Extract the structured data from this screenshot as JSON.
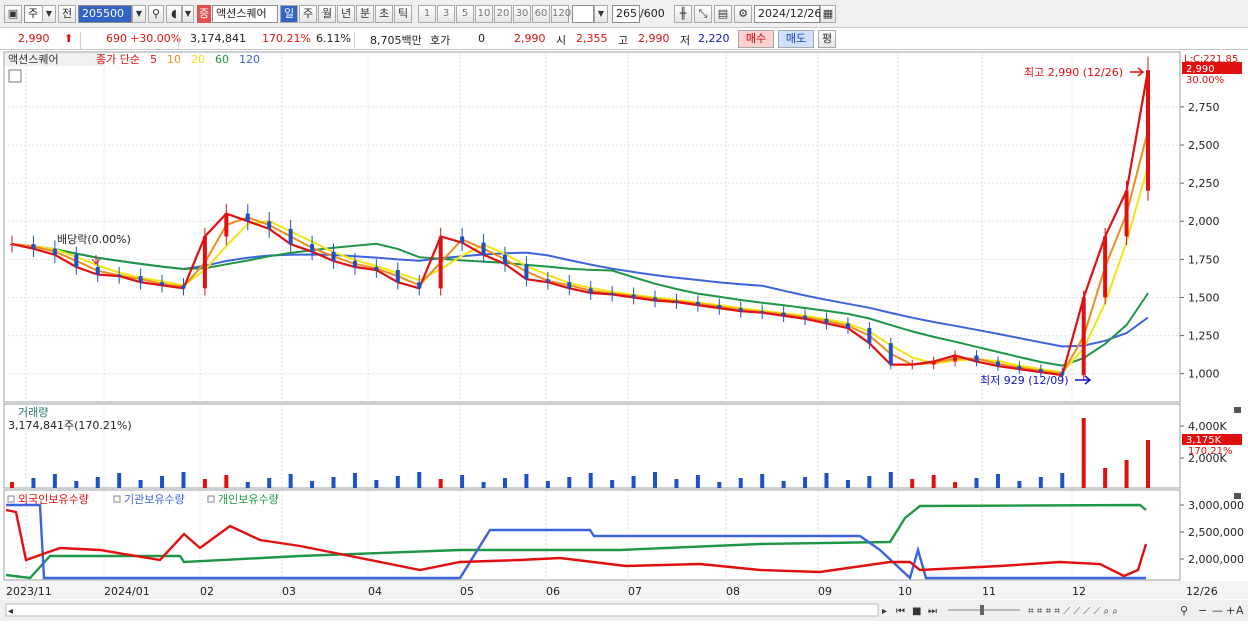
{
  "toolbar": {
    "type_selector": "주",
    "prev_label": "전",
    "code": "205500",
    "stock_badge": "증",
    "stock_name": "액션스퀘어",
    "periods": [
      "일",
      "주",
      "월",
      "년",
      "분",
      "초",
      "틱"
    ],
    "active_period": "일",
    "ranges": [
      "1",
      "3",
      "5",
      "10",
      "20",
      "30",
      "60",
      "120"
    ],
    "count": "265",
    "count_total": "/600",
    "date": "2024/12/26"
  },
  "info": {
    "price": "2,990",
    "change": "690",
    "change_pct": "+30.00%",
    "volume": "3,174,841",
    "volume_ratio": "170.21%",
    "turnover": "6.11%",
    "amount": "8,705백만",
    "quote_label": "호가",
    "quote": "0",
    "quote_price": "2,990",
    "open_label": "시",
    "open": "2,355",
    "high_label": "고",
    "high": "2,990",
    "low_label": "저",
    "low": "2,220",
    "buy_label": "매수",
    "sell_label": "매도",
    "avg_label": "평"
  },
  "price_panel": {
    "legend_stock": "액션스퀘어",
    "legend_ma_prefix": "종가 단순",
    "ma_periods": [
      "5",
      "10",
      "20",
      "60",
      "120"
    ],
    "ma_colors": [
      "#e01010",
      "#f08c1e",
      "#f0e614",
      "#1e9646",
      "#3c64dc"
    ],
    "top_label": "L:C:221.85",
    "current_tag": "2,990",
    "pct_label": "30.00%",
    "y_ticks": [
      "2,750",
      "2,500",
      "2,250",
      "2,000",
      "1,750",
      "1,500",
      "1,250",
      "1,000"
    ],
    "max_note": "최고 2,990 (12/26)",
    "min_note": "최저 929 (12/09)",
    "div_note": "배당락(0.00%)"
  },
  "volume_panel": {
    "title": "거래량",
    "value_line": "3,174,841주(170.21%)",
    "y_ticks": [
      "4,000K",
      "2,000K"
    ],
    "current_tag": "3,175K",
    "pct_label": "170.21%"
  },
  "holder_panel": {
    "legend": [
      "외국인보유수량",
      "기관보유수량",
      "개인보유수량"
    ],
    "legend_colors": [
      "#e01010",
      "#3c64dc",
      "#1e9646"
    ],
    "y_ticks": [
      "3,000,000",
      "2,500,000",
      "2,000,000"
    ]
  },
  "x_axis": {
    "labels": [
      "2023/11",
      "2024/01",
      "02",
      "03",
      "04",
      "05",
      "06",
      "07",
      "08",
      "09",
      "10",
      "11",
      "12"
    ],
    "end_label": "12/26"
  },
  "chart_data": {
    "type": "line",
    "series": [
      {
        "name": "종가",
        "values": [
          1850,
          1820,
          1780,
          1700,
          1650,
          1640,
          1600,
          1580,
          1560,
          1900,
          2050,
          2000,
          1950,
          1850,
          1800,
          1740,
          1700,
          1680,
          1600,
          1560,
          1900,
          1860,
          1780,
          1720,
          1620,
          1600,
          1560,
          1530,
          1520,
          1500,
          1480,
          1470,
          1450,
          1430,
          1410,
          1400,
          1380,
          1360,
          1330,
          1300,
          1200,
          1060,
          1060,
          1080,
          1120,
          1080,
          1050,
          1030,
          1010,
          990,
          1500,
          1900,
          2200,
          2990
        ]
      }
    ]
  }
}
